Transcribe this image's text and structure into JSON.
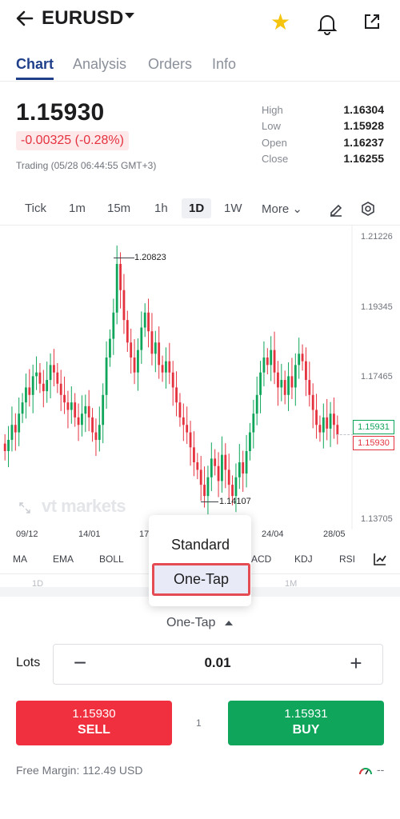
{
  "header": {
    "back_icon": "arrow-left-icon",
    "symbol": "EURUSD",
    "icons": [
      "chevron-down-icon",
      "star-icon",
      "bell-icon",
      "share-icon"
    ],
    "star_color": "#f5c40f"
  },
  "tabs": [
    {
      "label": "Chart",
      "active": true
    },
    {
      "label": "Analysis"
    },
    {
      "label": "Orders"
    },
    {
      "label": "Info"
    }
  ],
  "quote": {
    "price": "1.15930",
    "change": "-0.00325 (-0.28%)",
    "status": "Trading (05/28 06:44:55 GMT+3)",
    "stats": [
      {
        "label": "High",
        "value": "1.16304"
      },
      {
        "label": "Low",
        "value": "1.15928"
      },
      {
        "label": "Open",
        "value": "1.16237"
      },
      {
        "label": "Close",
        "value": "1.16255"
      }
    ]
  },
  "timeframes": [
    "Tick",
    "1m",
    "15m",
    "1h",
    "1D",
    "1W"
  ],
  "timeframe_active": "1D",
  "timeframe_more": "More",
  "chart_data": {
    "type": "candlestick",
    "y_ticks": [
      "1.21226",
      "1.19345",
      "1.17465",
      "1.13705"
    ],
    "x_ticks": [
      "09/12",
      "14/01",
      "17",
      "24/04",
      "28/05"
    ],
    "high_marker": "1.20823",
    "low_marker": "1.14107",
    "ask_label": "1.15931",
    "bid_label": "1.15930",
    "watermark": "vt markets",
    "up_color": "#0fa55a",
    "down_color": "#e5323f",
    "closes": [
      1.155,
      1.158,
      1.162,
      1.16,
      1.165,
      1.168,
      1.172,
      1.17,
      1.175,
      1.176,
      1.173,
      1.171,
      1.174,
      1.178,
      1.176,
      1.173,
      1.17,
      1.168,
      1.166,
      1.168,
      1.164,
      1.162,
      1.165,
      1.167,
      1.164,
      1.16,
      1.158,
      1.162,
      1.17,
      1.18,
      1.185,
      1.192,
      1.205,
      1.198,
      1.19,
      1.184,
      1.18,
      1.176,
      1.182,
      1.188,
      1.192,
      1.187,
      1.181,
      1.184,
      1.178,
      1.176,
      1.179,
      1.176,
      1.172,
      1.168,
      1.164,
      1.162,
      1.16,
      1.156,
      1.152,
      1.15,
      1.146,
      1.143,
      1.148,
      1.153,
      1.151,
      1.147,
      1.154,
      1.15,
      1.146,
      1.143,
      1.148,
      1.152,
      1.149,
      1.155,
      1.16,
      1.165,
      1.17,
      1.176,
      1.18,
      1.178,
      1.182,
      1.176,
      1.172,
      1.174,
      1.17,
      1.175,
      1.172,
      1.178,
      1.181,
      1.179,
      1.174,
      1.17,
      1.166,
      1.162,
      1.16,
      1.164,
      1.161,
      1.165,
      1.162,
      1.1593
    ]
  },
  "indicators": [
    "MA",
    "EMA",
    "BOLL",
    "ACD",
    "KDJ",
    "RSI"
  ],
  "faded_labels": [
    "1D",
    "1M"
  ],
  "order_type_menu": {
    "options": [
      "Standard",
      "One-Tap"
    ],
    "highlighted": "One-Tap",
    "highlight_color": "#e44b52"
  },
  "order_type_selected": "One-Tap",
  "lots": {
    "label": "Lots",
    "value": "0.01"
  },
  "sell": {
    "price": "1.15930",
    "label": "SELL",
    "color": "#f0303e"
  },
  "buy": {
    "price": "1.15931",
    "label": "BUY",
    "color": "#0fa55a"
  },
  "spread": "1",
  "free_margin": "Free Margin: 112.49 USD",
  "margin_level": "--"
}
